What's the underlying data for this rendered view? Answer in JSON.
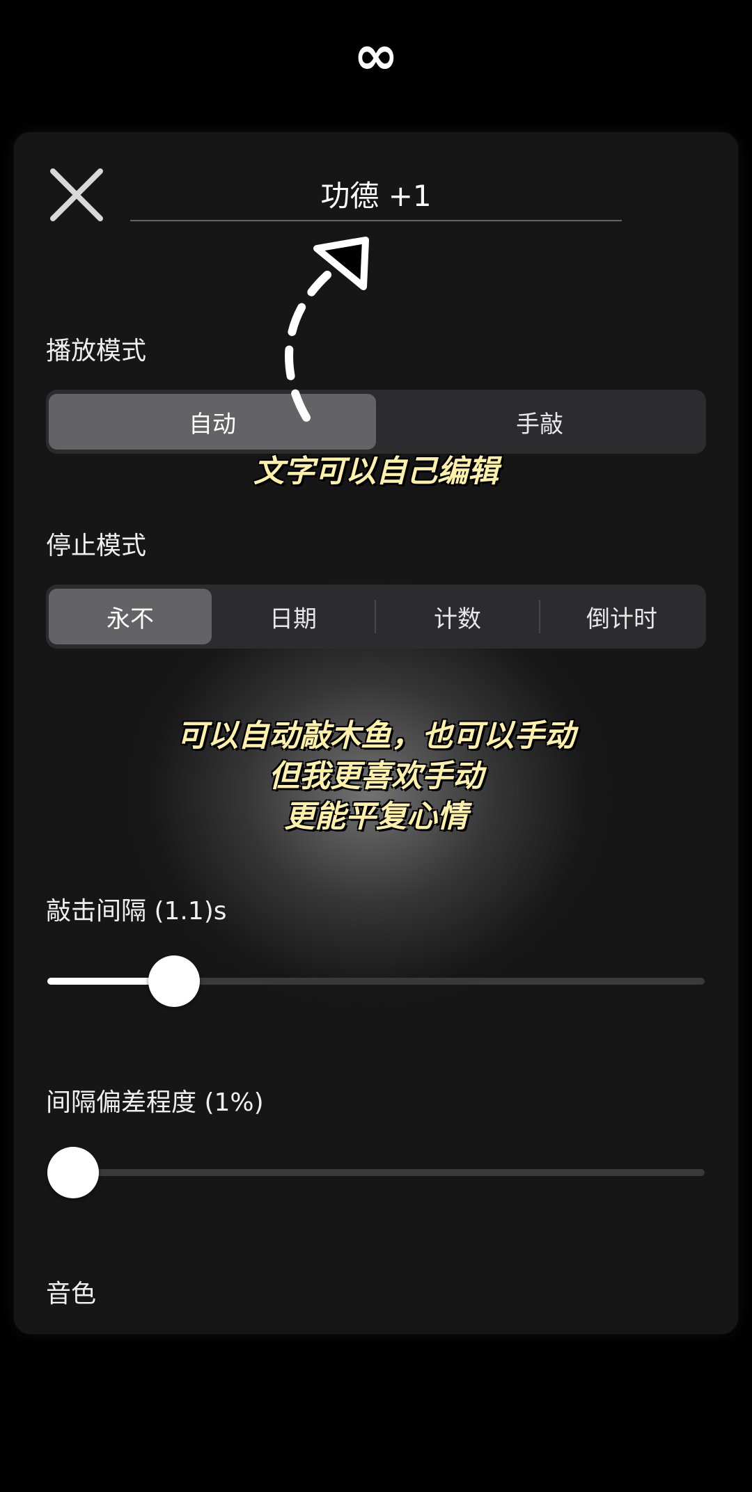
{
  "top": {
    "icon": "infinity-icon",
    "symbol": "∞"
  },
  "panel": {
    "close_icon": "close-icon",
    "title_value": "功德 +1"
  },
  "play_mode": {
    "label": "播放模式",
    "options": [
      "自动",
      "手敲"
    ],
    "selected": "自动"
  },
  "stop_mode": {
    "label": "停止模式",
    "options": [
      "永不",
      "日期",
      "计数",
      "倒计时"
    ],
    "selected": "永不"
  },
  "interval": {
    "label": "敲击间隔 (1.1)s",
    "fraction": 0.167
  },
  "deviation": {
    "label": "间隔偏差程度 (1%)",
    "fraction": 0.0
  },
  "tone": {
    "label": "音色"
  },
  "overlay": {
    "caption1": "文字可以自己编辑",
    "caption2_lines": [
      "可以自动敲木鱼，也可以手动",
      "但我更喜欢手动",
      "更能平复心情"
    ]
  },
  "colors": {
    "background": "#000000",
    "panel": "#161616",
    "segment_bg": "#2c2c2e",
    "segment_active": "#636366",
    "caption": "#fdf0a8"
  }
}
